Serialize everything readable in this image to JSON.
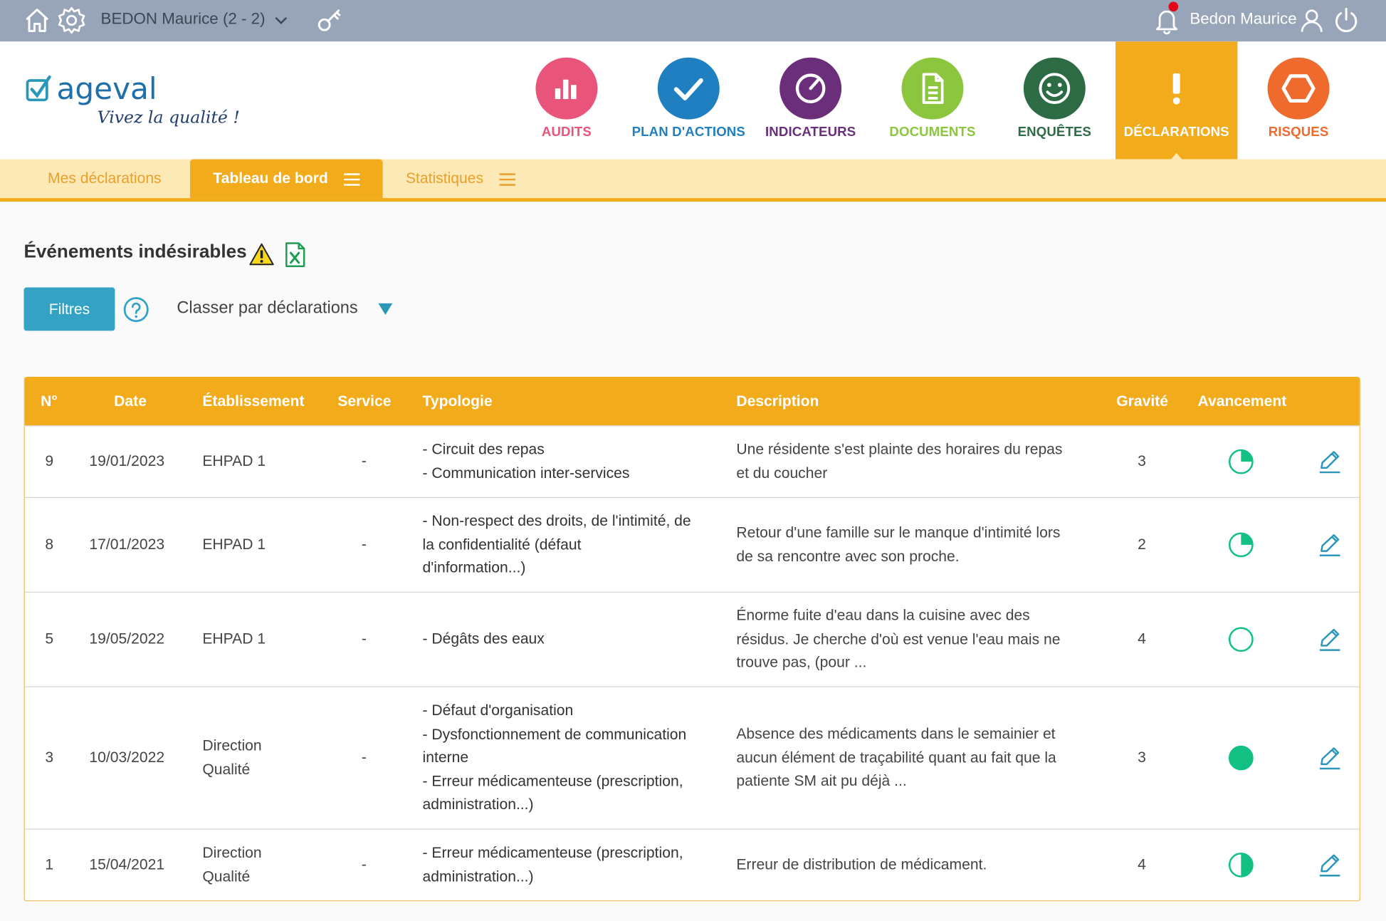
{
  "topbar": {
    "site_label": "BEDON Maurice (2 - 2)",
    "user_name": "Bedon Maurice",
    "notification_color": "#e1071a"
  },
  "modules": [
    {
      "label": "AUDITS",
      "color": "#e8547a",
      "icon": "bar-chart-icon"
    },
    {
      "label": "PLAN D'ACTIONS",
      "color": "#1f7fc1",
      "icon": "check-icon"
    },
    {
      "label": "INDICATEURS",
      "color": "#6b2e7a",
      "icon": "gauge-icon"
    },
    {
      "label": "DOCUMENTS",
      "color": "#8cc63e",
      "icon": "document-icon"
    },
    {
      "label": "ENQUÊTES",
      "color": "#2d6b45",
      "icon": "smiley-icon"
    },
    {
      "label": "DÉCLARATIONS",
      "color": "#f2ab1b",
      "icon": "exclamation-icon",
      "active": true
    },
    {
      "label": "RISQUES",
      "color": "#ef6a2d",
      "icon": "hexagon-icon"
    }
  ],
  "subnav": {
    "tabs": [
      {
        "label": "Mes déclarations"
      },
      {
        "label": "Tableau de bord",
        "active": true
      },
      {
        "label": "Statistiques"
      }
    ]
  },
  "logo": {
    "brand": "ageval",
    "tagline": "Vivez la qualité !"
  },
  "page": {
    "title": "Événements indésirables",
    "filter_button": "Filtres",
    "sort_label": "Classer par déclarations"
  },
  "table": {
    "headers": [
      "N°",
      "Date",
      "Établissement",
      "Service",
      "Typologie",
      "Description",
      "Gravité",
      "Avancement"
    ],
    "rows": [
      {
        "num": "9",
        "date": "19/01/2023",
        "etab": [
          "EHPAD 1"
        ],
        "service": "-",
        "typologie": [
          "- Circuit des repas",
          "- Communication inter-services"
        ],
        "description": [
          "Une résidente s'est plainte des horaires du repas",
          "et du coucher"
        ],
        "gravite": "3",
        "avancement": 0.25
      },
      {
        "num": "8",
        "date": "17/01/2023",
        "etab": [
          "EHPAD 1"
        ],
        "service": "-",
        "typologie": [
          "- Non-respect des droits, de l'intimité, de",
          "la confidentialité (défaut",
          "d'information...)"
        ],
        "description": [
          "Retour d'une famille sur le manque d'intimité lors",
          "de sa rencontre avec son proche."
        ],
        "gravite": "2",
        "avancement": 0.25
      },
      {
        "num": "5",
        "date": "19/05/2022",
        "etab": [
          "EHPAD 1"
        ],
        "service": "-",
        "typologie": [
          "- Dégâts des eaux"
        ],
        "description": [
          "Énorme fuite d'eau dans la cuisine avec des",
          "résidus. Je cherche d'où est venue l'eau mais ne",
          "trouve pas, (pour ..."
        ],
        "gravite": "4",
        "avancement": 0
      },
      {
        "num": "3",
        "date": "10/03/2022",
        "etab": [
          "Direction",
          "Qualité"
        ],
        "service": "-",
        "typologie": [
          "- Défaut d'organisation",
          "- Dysfonctionnement de communication",
          "interne",
          "- Erreur médicamenteuse (prescription,",
          "administration...)"
        ],
        "description": [
          "Absence des médicaments dans le semainier et",
          "aucun élément de traçabilité quant au fait que la",
          "patiente SM ait pu déjà ..."
        ],
        "gravite": "3",
        "avancement": 1
      },
      {
        "num": "1",
        "date": "15/04/2021",
        "etab": [
          "Direction",
          "Qualité"
        ],
        "service": "-",
        "typologie": [
          "- Erreur médicamenteuse (prescription,",
          "administration...)"
        ],
        "description": [
          "Erreur de distribution de médicament."
        ],
        "gravite": "4",
        "avancement": 0.5
      }
    ]
  },
  "colors": {
    "accent": "#f2ab1b",
    "accent_light": "#fde9b6",
    "button": "#33a2c5",
    "progress": "#12c083",
    "edit_icon": "#2b97b8"
  }
}
